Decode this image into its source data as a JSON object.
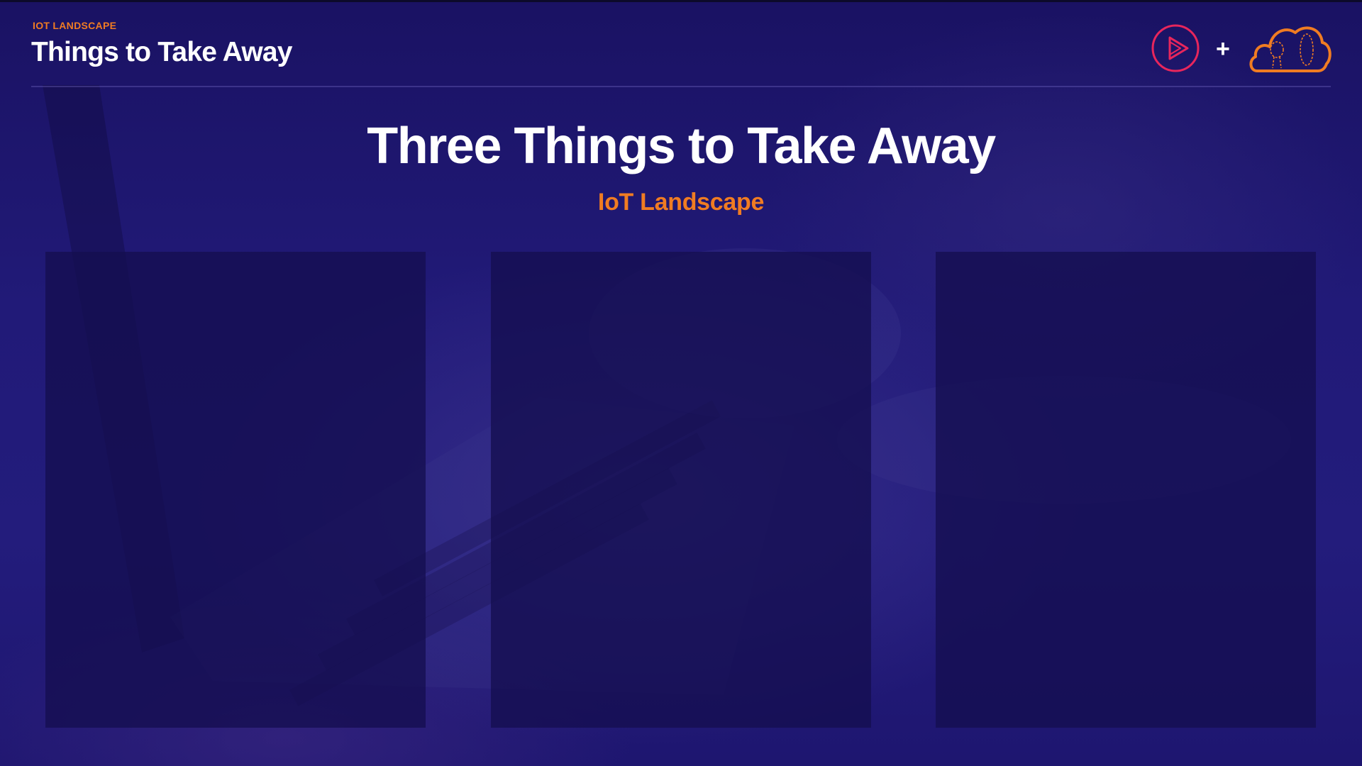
{
  "header": {
    "eyebrow": "IOT LANDSCAPE",
    "title": "Things to Take Away"
  },
  "brand": {
    "left_logo_icon": "play-circle-icon",
    "separator": "+",
    "right_logo_icon": "cloud-icon",
    "left_logo_color": "#e8265c",
    "right_logo_color": "#f07c22"
  },
  "main": {
    "title": "Three Things to Take Away",
    "subtitle": "IoT Landscape"
  },
  "panels": [
    {
      "id": "panel-1"
    },
    {
      "id": "panel-2"
    },
    {
      "id": "panel-3"
    }
  ],
  "colors": {
    "background": "#211a78",
    "accent": "#f07c22",
    "text": "#ffffff"
  }
}
